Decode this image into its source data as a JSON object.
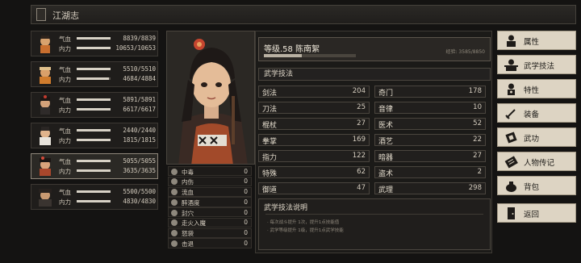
{
  "header": {
    "title": "江湖志"
  },
  "party": [
    {
      "hp_label": "气血",
      "hp": "8839/8839",
      "mp_label": "内力",
      "mp": "10653/10653",
      "hp_frac": 1.0,
      "mp_frac": 1.0
    },
    {
      "hp_label": "气血",
      "hp": "5510/5510",
      "mp_label": "内力",
      "mp": "4684/4884",
      "hp_frac": 1.0,
      "mp_frac": 0.96
    },
    {
      "hp_label": "气血",
      "hp": "5891/5891",
      "mp_label": "内力",
      "mp": "6617/6617",
      "hp_frac": 1.0,
      "mp_frac": 1.0
    },
    {
      "hp_label": "气血",
      "hp": "2440/2440",
      "mp_label": "内力",
      "mp": "1815/1815",
      "hp_frac": 1.0,
      "mp_frac": 1.0
    },
    {
      "hp_label": "气血",
      "hp": "5055/5055",
      "mp_label": "内力",
      "mp": "3635/3635",
      "hp_frac": 1.0,
      "mp_frac": 1.0
    },
    {
      "hp_label": "气血",
      "hp": "5500/5500",
      "mp_label": "内力",
      "mp": "4830/4830",
      "hp_frac": 1.0,
      "mp_frac": 1.0
    }
  ],
  "character": {
    "name_line": "等级.58 陈南絮",
    "xp_text": "经验: 3585/8850",
    "xp_frac": 0.41
  },
  "status_effects": [
    {
      "name": "中毒",
      "value": "0"
    },
    {
      "name": "内伤",
      "value": "0"
    },
    {
      "name": "流血",
      "value": "0"
    },
    {
      "name": "醉酒度",
      "value": "0"
    },
    {
      "name": "封穴",
      "value": "0"
    },
    {
      "name": "走火入魔",
      "value": "0"
    },
    {
      "name": "怒袋",
      "value": "0"
    },
    {
      "name": "击退",
      "value": "0"
    }
  ],
  "skills_title": "武学技法",
  "skills_left": [
    {
      "name": "剑法",
      "value": "204"
    },
    {
      "name": "刀法",
      "value": "25"
    },
    {
      "name": "棍杖",
      "value": "27"
    },
    {
      "name": "拳掌",
      "value": "169"
    },
    {
      "name": "指力",
      "value": "122"
    },
    {
      "name": "特殊",
      "value": "62"
    },
    {
      "name": "御道",
      "value": "47"
    }
  ],
  "skills_right": [
    {
      "name": "奇门",
      "value": "178"
    },
    {
      "name": "音律",
      "value": "10"
    },
    {
      "name": "医术",
      "value": "52"
    },
    {
      "name": "酒艺",
      "value": "22"
    },
    {
      "name": "暗器",
      "value": "27"
    },
    {
      "name": "盗术",
      "value": "2"
    },
    {
      "name": "武理",
      "value": "298"
    }
  ],
  "description": {
    "title": "武学技法说明",
    "line1": "· 每次战斗提升 1次，提升1点技能值",
    "line2": "· 武学等级提升 1级，提升1点武学技能"
  },
  "menu": [
    {
      "label": "属性",
      "icon": "attributes-icon"
    },
    {
      "label": "武学技法",
      "icon": "martial-skills-icon"
    },
    {
      "label": "特性",
      "icon": "traits-icon"
    },
    {
      "label": "装备",
      "icon": "sword-icon"
    },
    {
      "label": "武功",
      "icon": "scroll-icon"
    },
    {
      "label": "人物传记",
      "icon": "biography-icon"
    },
    {
      "label": "背包",
      "icon": "bag-icon"
    },
    {
      "label": "返回",
      "icon": "door-icon"
    }
  ]
}
